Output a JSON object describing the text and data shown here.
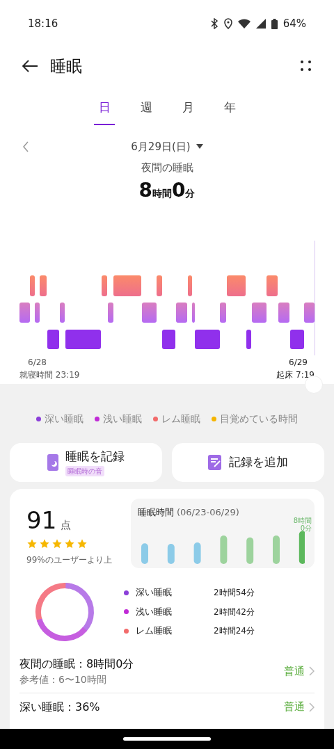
{
  "status_bar": {
    "time": "18:16",
    "battery": "64%"
  },
  "header": {
    "title": "睡眠"
  },
  "tabs": [
    {
      "label": "日",
      "selected": true
    },
    {
      "label": "週",
      "selected": false
    },
    {
      "label": "月",
      "selected": false
    },
    {
      "label": "年",
      "selected": false
    }
  ],
  "date": "6月29日(日)",
  "summary": {
    "label": "夜間の睡眠",
    "hours": "8",
    "hours_unit": "時間",
    "minutes": "0",
    "minutes_unit": "分"
  },
  "timeline": {
    "start_date": "6/28",
    "start_label": "就寝時間 23:19",
    "end_date": "6/29",
    "end_label": "起床 7:19"
  },
  "legend": [
    {
      "label": "深い睡眠",
      "color": "#8b3fd9"
    },
    {
      "label": "浅い睡眠",
      "color": "#c02ad6"
    },
    {
      "label": "レム睡眠",
      "color": "#f26b6b"
    },
    {
      "label": "目覚めている時間",
      "color": "#f5b400"
    }
  ],
  "actions": [
    {
      "label": "睡眠を記録",
      "badge": "睡眠時の音",
      "kind": "record"
    },
    {
      "label": "記録を追加",
      "kind": "add"
    }
  ],
  "score": {
    "value": "91",
    "unit": "点",
    "stars": 5,
    "comparison": "99%のユーザーより上"
  },
  "weekly": {
    "title": "睡眠時間",
    "range": "(06/23-06/29)",
    "last_label": "8時間\n0分"
  },
  "breakdown": [
    {
      "label": "深い睡眠",
      "value": "2時間54分",
      "color": "#8b3fd9"
    },
    {
      "label": "浅い睡眠",
      "value": "2時間42分",
      "color": "#c02ad6"
    },
    {
      "label": "レム睡眠",
      "value": "2時間24分",
      "color": "#f26b6b"
    }
  ],
  "metrics": [
    {
      "title": "夜間の睡眠：8時間0分",
      "reference": "参考値：6〜10時間",
      "rating": "普通"
    },
    {
      "title": "深い睡眠：36%",
      "rating": "普通"
    }
  ]
}
